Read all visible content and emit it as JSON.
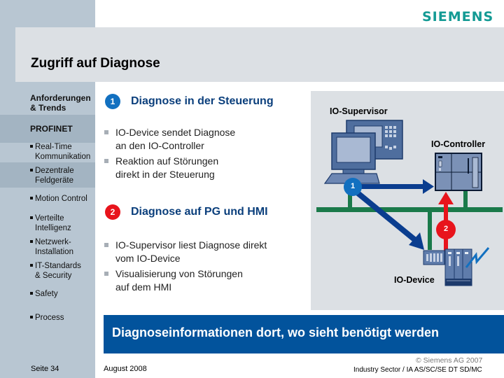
{
  "header": {
    "title": "Zugriff auf Diagnose",
    "logo": "SIEMENS",
    "logo_color": "#139a94"
  },
  "sidebar": {
    "section1": [
      "Anforderungen",
      "& Trends"
    ],
    "section2": "PROFINET",
    "items": [
      {
        "lines": [
          "Real-Time",
          "Kommunikation"
        ]
      },
      {
        "lines": [
          "Dezentrale",
          "Feldgeräte"
        ],
        "highlighted": true
      },
      {
        "lines": [
          "Motion Control"
        ]
      },
      {
        "lines": [
          "Verteilte",
          "Intelligenz"
        ]
      },
      {
        "lines": [
          "Netzwerk-",
          "Installation"
        ]
      },
      {
        "lines": [
          "IT-Standards",
          "& Security"
        ]
      },
      {
        "lines": [
          "Safety"
        ]
      },
      {
        "lines": [
          "Process"
        ]
      }
    ]
  },
  "main": {
    "sections": [
      {
        "badge": "1",
        "badge_color": "#1270c0",
        "title": "Diagnose in der Steuerung",
        "bullets": [
          [
            "IO-Device sendet Diagnose",
            "an den IO-Controller"
          ],
          [
            "Reaktion auf Störungen",
            "direkt in der Steuerung"
          ]
        ]
      },
      {
        "badge": "2",
        "badge_color": "#e8141c",
        "title": "Diagnose auf PG und HMI",
        "bullets": [
          [
            "IO-Supervisor liest Diagnose direkt",
            "vom IO-Device"
          ],
          [
            "Visualisierung  von Störungen",
            "auf dem HMI"
          ]
        ]
      }
    ]
  },
  "diagram": {
    "supervisor_label": "IO-Supervisor",
    "controller_label": "IO-Controller",
    "device_label": "IO-Device",
    "marker1": "1",
    "marker2": "2",
    "network_color": "#1a7a4a",
    "arrow1_color": "#0a3d8f",
    "arrow2_color": "#e8141c"
  },
  "banner": {
    "text": "Diagnoseinformationen dort, wo sieht benötigt werden",
    "color": "#02539c"
  },
  "footer": {
    "page": "Seite 34",
    "date": "August 2008",
    "copyright": "© Siemens AG 2007",
    "org": "Industry Sector / IA AS/SC/SE DT SD/MC"
  }
}
